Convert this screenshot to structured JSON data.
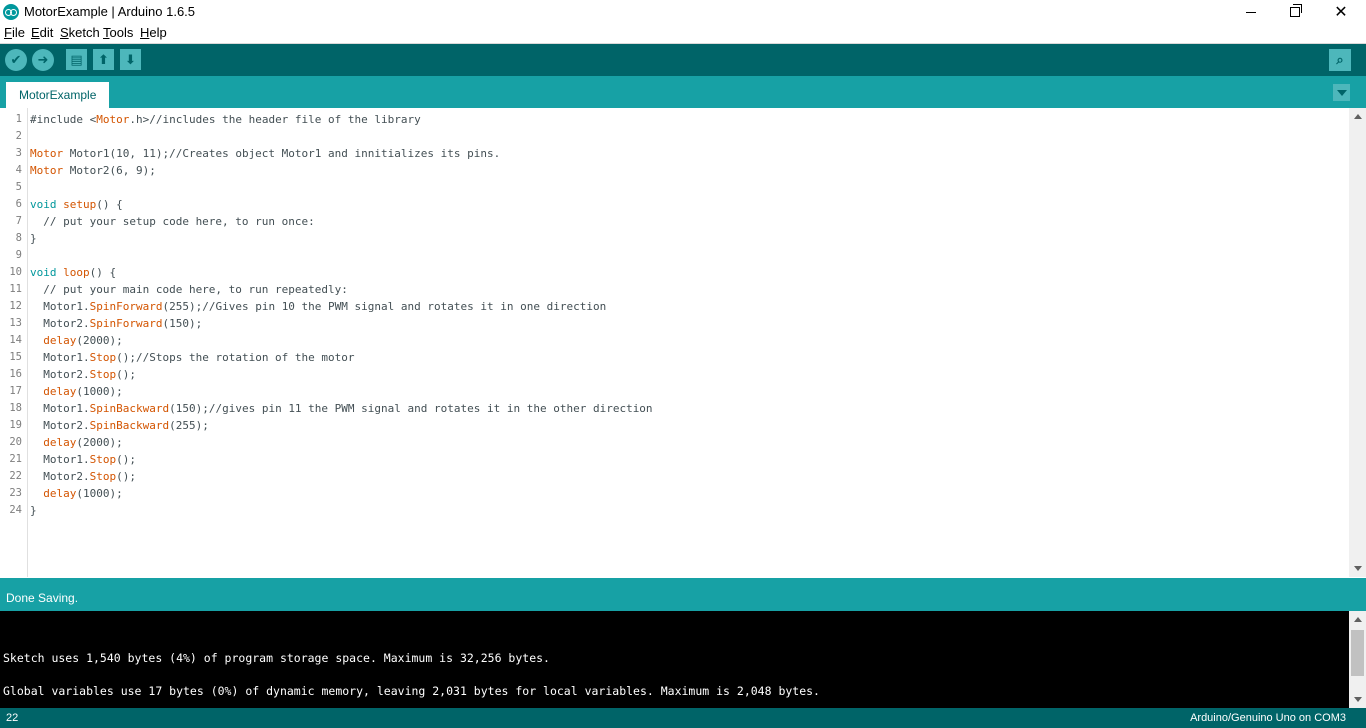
{
  "window": {
    "title": "MotorExample | Arduino 1.6.5",
    "close_glyph": "✕"
  },
  "menu": {
    "items": [
      "File",
      "Edit",
      "Sketch",
      "Tools",
      "Help"
    ]
  },
  "toolbar": {
    "verify_glyph": "✔",
    "upload_glyph": "➜",
    "new_glyph": "▤",
    "open_glyph": "⬆",
    "save_glyph": "⬇",
    "serial_glyph": "⌕",
    "icon_color": "#4db7bb",
    "background": "#006468"
  },
  "tabs": [
    {
      "label": "MotorExample"
    }
  ],
  "editor": {
    "line_numbers": [
      "1",
      "2",
      "3",
      "4",
      "5",
      "6",
      "7",
      "8",
      "9",
      "10",
      "11",
      "12",
      "13",
      "14",
      "15",
      "16",
      "17",
      "18",
      "19",
      "20",
      "21",
      "22",
      "23",
      "24"
    ],
    "lines": [
      [
        {
          "t": "#include <"
        },
        {
          "t": "Motor",
          "c": "kw"
        },
        {
          "t": ".h>"
        },
        {
          "t": "//includes the header file of the library"
        }
      ],
      [],
      [
        {
          "t": "Motor",
          "c": "kw"
        },
        {
          "t": " Motor1(10, 11);"
        },
        {
          "t": "//Creates object Motor1 and innitializes its pins."
        }
      ],
      [
        {
          "t": "Motor",
          "c": "kw"
        },
        {
          "t": " Motor2(6, 9);"
        }
      ],
      [],
      [
        {
          "t": "void",
          "c": "kw2"
        },
        {
          "t": " "
        },
        {
          "t": "setup",
          "c": "kw"
        },
        {
          "t": "() {"
        }
      ],
      [
        {
          "t": "  // put your setup code here, to run once:"
        }
      ],
      [
        {
          "t": "}"
        }
      ],
      [],
      [
        {
          "t": "void",
          "c": "kw2"
        },
        {
          "t": " "
        },
        {
          "t": "loop",
          "c": "kw"
        },
        {
          "t": "() {"
        }
      ],
      [
        {
          "t": "  // put your main code here, to run repeatedly:"
        }
      ],
      [
        {
          "t": "  Motor1."
        },
        {
          "t": "SpinForward",
          "c": "kw"
        },
        {
          "t": "(255);"
        },
        {
          "t": "//Gives pin 10 the PWM signal and rotates it in one direction"
        }
      ],
      [
        {
          "t": "  Motor2."
        },
        {
          "t": "SpinForward",
          "c": "kw"
        },
        {
          "t": "(150);"
        }
      ],
      [
        {
          "t": "  "
        },
        {
          "t": "delay",
          "c": "kw"
        },
        {
          "t": "(2000);"
        }
      ],
      [
        {
          "t": "  Motor1."
        },
        {
          "t": "Stop",
          "c": "kw"
        },
        {
          "t": "();"
        },
        {
          "t": "//Stops the rotation of the motor"
        }
      ],
      [
        {
          "t": "  Motor2."
        },
        {
          "t": "Stop",
          "c": "kw"
        },
        {
          "t": "();"
        }
      ],
      [
        {
          "t": "  "
        },
        {
          "t": "delay",
          "c": "kw"
        },
        {
          "t": "(1000);"
        }
      ],
      [
        {
          "t": "  Motor1."
        },
        {
          "t": "SpinBackward",
          "c": "kw"
        },
        {
          "t": "(150);"
        },
        {
          "t": "//gives pin 11 the PWM signal and rotates it in the other direction"
        }
      ],
      [
        {
          "t": "  Motor2."
        },
        {
          "t": "SpinBackward",
          "c": "kw"
        },
        {
          "t": "(255);"
        }
      ],
      [
        {
          "t": "  "
        },
        {
          "t": "delay",
          "c": "kw"
        },
        {
          "t": "(2000);"
        }
      ],
      [
        {
          "t": "  Motor1."
        },
        {
          "t": "Stop",
          "c": "kw"
        },
        {
          "t": "();"
        }
      ],
      [
        {
          "t": "  Motor2."
        },
        {
          "t": "Stop",
          "c": "kw"
        },
        {
          "t": "();"
        }
      ],
      [
        {
          "t": "  "
        },
        {
          "t": "delay",
          "c": "kw"
        },
        {
          "t": "(1000);"
        }
      ],
      [
        {
          "t": "}"
        }
      ]
    ],
    "colors": {
      "default": "#434f54",
      "keyword": "#d35400",
      "type": "#00979c",
      "line_number": "#7e7e7e"
    }
  },
  "status": {
    "message": "Done Saving."
  },
  "console": {
    "lines": [
      "Sketch uses 1,540 bytes (4%) of program storage space. Maximum is 32,256 bytes.",
      "Global variables use 17 bytes (0%) of dynamic memory, leaving 2,031 bytes for local variables. Maximum is 2,048 bytes."
    ]
  },
  "footer": {
    "line_number": "22",
    "board": "Arduino/Genuino Uno on COM3"
  },
  "theme": {
    "dark_teal": "#006468",
    "teal": "#17a1a5"
  }
}
